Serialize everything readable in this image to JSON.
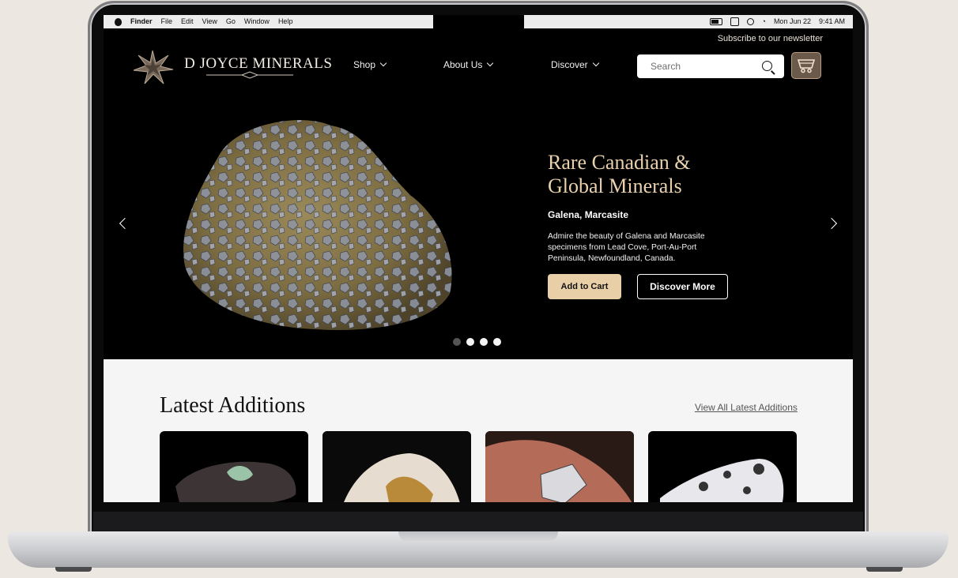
{
  "menubar": {
    "items": [
      "Finder",
      "File",
      "Edit",
      "View",
      "Go",
      "Window",
      "Help"
    ],
    "date": "Mon Jun 22",
    "time": "9:41 AM"
  },
  "header": {
    "newsletter": "Subscribe to our newsletter",
    "brand": "D JOYCE MINERALS",
    "nav": [
      "Shop",
      "About Us",
      "Discover"
    ],
    "search_placeholder": "Search"
  },
  "hero": {
    "title_line1": "Rare Canadian &",
    "title_line2": "Global Minerals",
    "subtitle": "Galena, Marcasite",
    "description": "Admire the beauty of Galena and Marcasite specimens from Lead Cove, Port-Au-Port Peninsula, Newfoundland, Canada.",
    "add_to_cart": "Add to Cart",
    "discover_more": "Discover More",
    "slide_count": 4,
    "active_slide": 1
  },
  "latest": {
    "title": "Latest Additions",
    "view_all": "View All Latest Additions"
  },
  "colors": {
    "accent": "#e8cfa8",
    "hero_title": "#e9d1ae",
    "cart_button": "#6b5a4a",
    "page_background": "#000000",
    "section_background": "#f5f5f5"
  }
}
